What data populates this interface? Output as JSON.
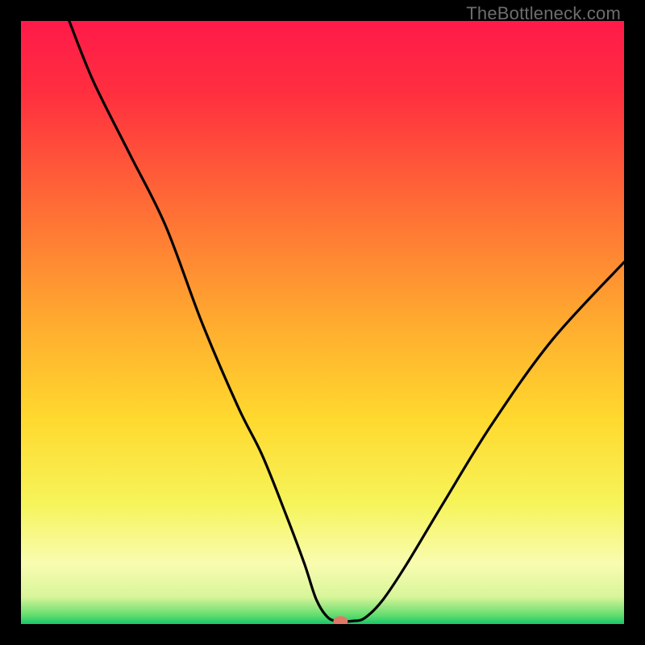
{
  "watermark": "TheBottleneck.com",
  "chart_data": {
    "type": "line",
    "title": "",
    "xlabel": "",
    "ylabel": "",
    "xlim": [
      0,
      100
    ],
    "ylim": [
      0,
      100
    ],
    "grid": false,
    "legend": false,
    "description": "V-shaped bottleneck curve over a vertical green-yellow-red gradient. Left arm descends steeply from top-left; minimum near x≈53 at y≈0; right arm rises to about y≈60 at x=100. A small salmon-colored marker sits at the curve's minimum.",
    "series": [
      {
        "name": "bottleneck-curve",
        "x": [
          8,
          12,
          18,
          24,
          30,
          36,
          40,
          44,
          47,
          49,
          51,
          53,
          55,
          57,
          60,
          64,
          70,
          78,
          88,
          100
        ],
        "y": [
          100,
          90,
          78,
          66,
          50,
          36,
          28,
          18,
          10,
          4,
          1,
          0.5,
          0.5,
          1,
          4,
          10,
          20,
          33,
          47,
          60
        ]
      }
    ],
    "marker": {
      "x": 53,
      "y": 0.5,
      "color": "#e07868",
      "rx": 9,
      "ry": 6
    },
    "gradient_stops": [
      {
        "offset": 0.0,
        "color": "#ff1a4a"
      },
      {
        "offset": 0.12,
        "color": "#ff2f3f"
      },
      {
        "offset": 0.3,
        "color": "#ff6a36"
      },
      {
        "offset": 0.5,
        "color": "#ffab2f"
      },
      {
        "offset": 0.66,
        "color": "#ffd92e"
      },
      {
        "offset": 0.8,
        "color": "#f6f45a"
      },
      {
        "offset": 0.9,
        "color": "#f9fcb0"
      },
      {
        "offset": 0.955,
        "color": "#d8f59a"
      },
      {
        "offset": 0.985,
        "color": "#65dd6e"
      },
      {
        "offset": 1.0,
        "color": "#17c76a"
      }
    ]
  }
}
